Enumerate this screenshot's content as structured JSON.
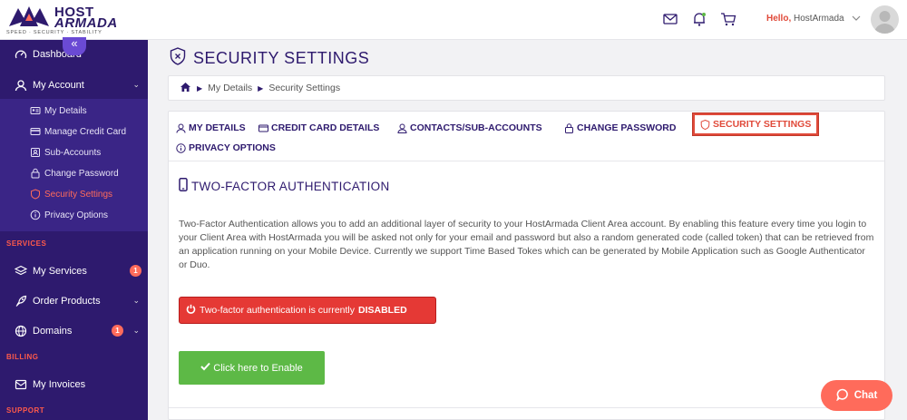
{
  "brand": {
    "name_line1": "HOST",
    "name_line2": "ARMADA",
    "tagline": "SPEED · SECURITY · STABILITY",
    "primary_color": "#2e1a6e",
    "accent_color": "#ff6b5b"
  },
  "header": {
    "icons": [
      "mail-icon",
      "bell-icon",
      "cart-icon"
    ],
    "hello_label": "Hello,",
    "user_name": "HostArmada"
  },
  "sidebar": {
    "collapse_glyph": "«",
    "dashboard": "Dashboard",
    "my_account": "My Account",
    "account_items": [
      {
        "label": "My Details",
        "icon": "id-card-icon"
      },
      {
        "label": "Manage Credit Card",
        "icon": "credit-card-icon"
      },
      {
        "label": "Sub-Accounts",
        "icon": "user-box-icon"
      },
      {
        "label": "Change Password",
        "icon": "lock-icon"
      },
      {
        "label": "Security Settings",
        "icon": "shield-icon",
        "active": true
      },
      {
        "label": "Privacy Options",
        "icon": "info-icon"
      }
    ],
    "services_label": "SERVICES",
    "my_services": "My Services",
    "my_services_badge": "1",
    "order_products": "Order Products",
    "domains": "Domains",
    "domains_badge": "1",
    "billing_label": "BILLING",
    "my_invoices": "My Invoices",
    "support_label": "SUPPORT"
  },
  "page": {
    "title": "SECURITY SETTINGS",
    "breadcrumb": [
      "My Details",
      "Security Settings"
    ]
  },
  "tabs": [
    {
      "label": "MY DETAILS",
      "icon": "user-icon"
    },
    {
      "label": "CREDIT CARD DETAILS",
      "icon": "card-icon"
    },
    {
      "label": "CONTACTS/SUB-ACCOUNTS",
      "icon": "contacts-icon"
    },
    {
      "label": "CHANGE PASSWORD",
      "icon": "lock-icon"
    },
    {
      "label": "SECURITY SETTINGS",
      "icon": "shield-icon",
      "active": true
    },
    {
      "label": "PRIVACY OPTIONS",
      "icon": "info-icon"
    }
  ],
  "tfa": {
    "title": "TWO-FACTOR AUTHENTICATION",
    "description": "Two-Factor Authentication allows you to add an additional layer of security to your HostArmada Client Area account. By enabling this feature every time you login to your Client Area with HostArmada you will be asked not only for your email and password but also a random generated code (called token) that can be retrieved from an application running on your Mobile Device. Currently we support Time Based Tokes which can be generated by Mobile Application such as Google Authenticator or Duo.",
    "status_text": "Two-factor authentication is currently",
    "status_value": "DISABLED",
    "enable_label": "Click here to Enable"
  },
  "chat": {
    "label": "Chat"
  }
}
